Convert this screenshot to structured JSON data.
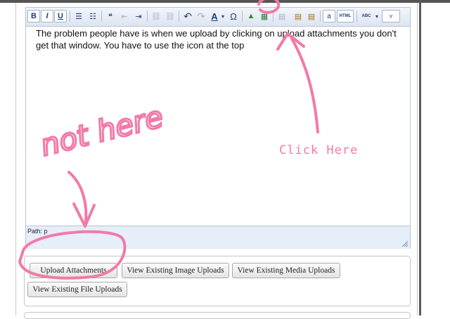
{
  "toolbar": {
    "buttons": [
      {
        "id": "bold",
        "glyph": "B"
      },
      {
        "id": "italic",
        "glyph": "I"
      },
      {
        "id": "underline",
        "glyph": "U"
      },
      {
        "id": "bullet-list",
        "glyph": "☰"
      },
      {
        "id": "numbered-list",
        "glyph": "☷"
      },
      {
        "id": "quote",
        "glyph": "❝"
      },
      {
        "id": "outdent",
        "glyph": "⇤"
      },
      {
        "id": "indent",
        "glyph": "⇥"
      },
      {
        "id": "link",
        "glyph": "⛓"
      },
      {
        "id": "unlink",
        "glyph": "⛓"
      },
      {
        "id": "undo",
        "glyph": "↶"
      },
      {
        "id": "redo",
        "glyph": "↷"
      },
      {
        "id": "font-color",
        "glyph": "A"
      },
      {
        "id": "special-char",
        "glyph": "Ω"
      },
      {
        "id": "insert-image",
        "glyph": "▲"
      },
      {
        "id": "insert-media",
        "glyph": "▦"
      },
      {
        "id": "paste",
        "glyph": "▤"
      },
      {
        "id": "paste-text",
        "glyph": "▤"
      },
      {
        "id": "paste-word",
        "glyph": "▤"
      },
      {
        "id": "select-all",
        "glyph": "a"
      },
      {
        "id": "html-source",
        "glyph": "HTML"
      },
      {
        "id": "spellcheck",
        "glyph": "ABC"
      },
      {
        "id": "more",
        "glyph": "▾"
      }
    ]
  },
  "editor": {
    "body_text": "The problem people have is when we upload by clicking on upload attachments you don't get that window. You have to use the icon at the top",
    "path_label": "Path: p"
  },
  "attachments": {
    "upload_label": "Upload Attachments",
    "image_label": "View Existing Image Uploads",
    "media_label": "View Existing Media Uploads",
    "file_label": "View Existing File Uploads"
  },
  "annotations": {
    "click_here": "Click Here",
    "not_here": "not here",
    "color": "#f27aa8"
  }
}
